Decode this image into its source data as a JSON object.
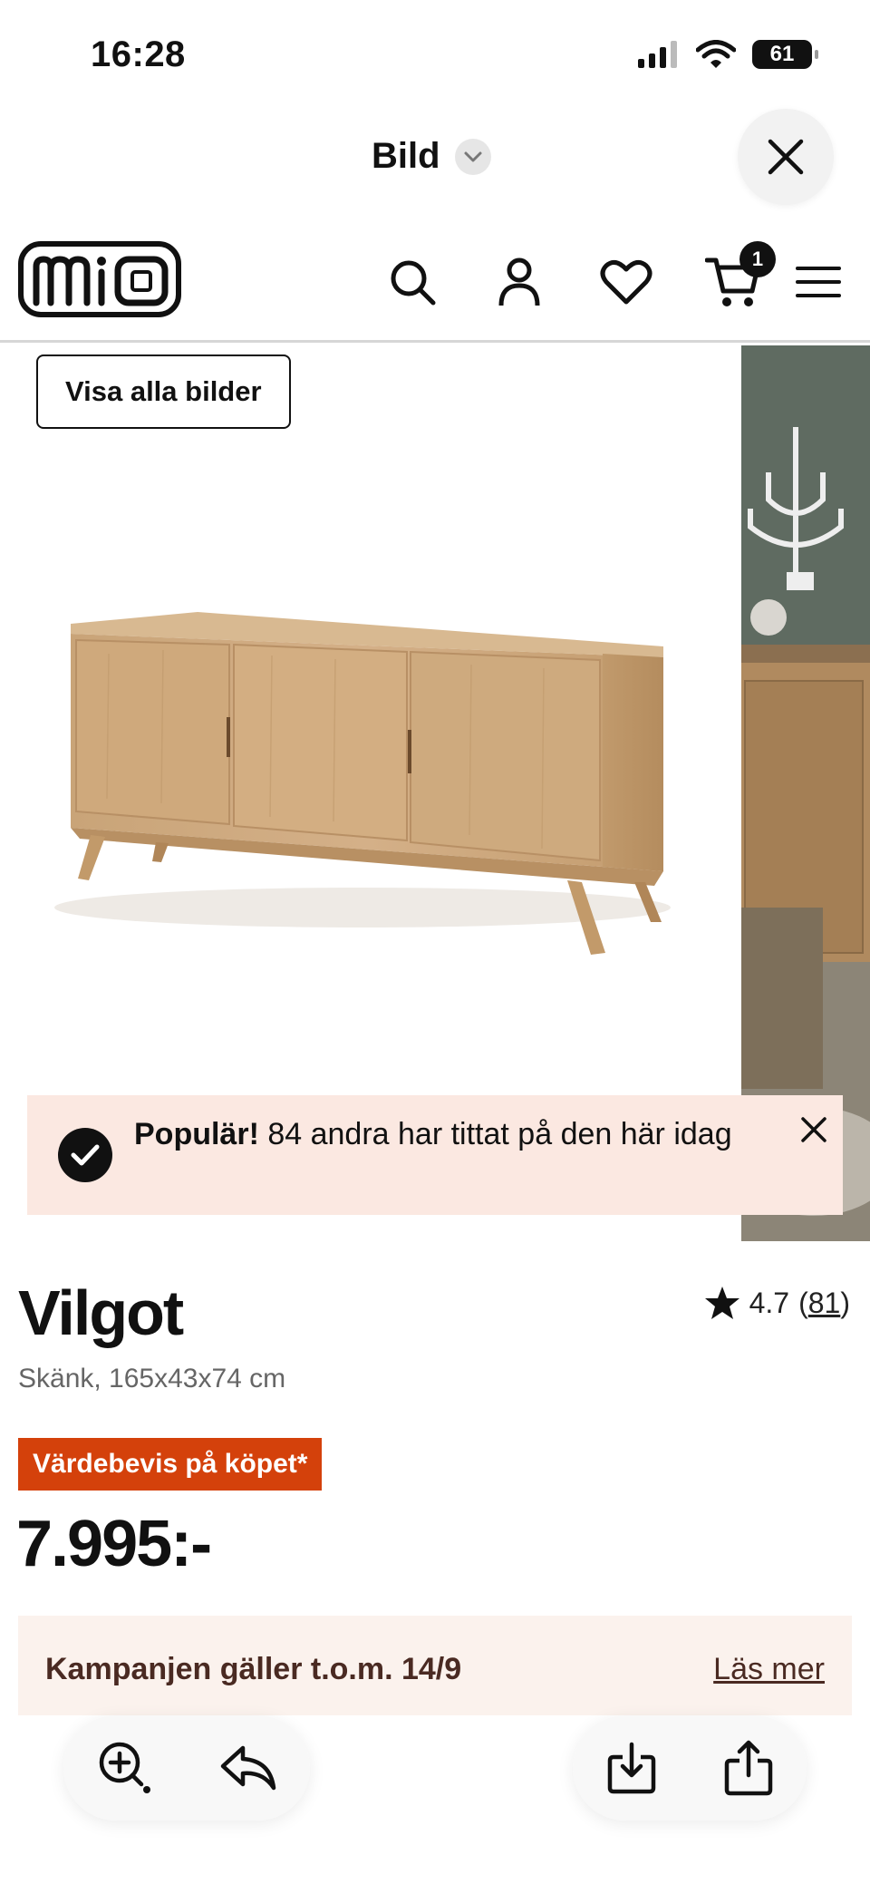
{
  "status_bar": {
    "time": "16:28",
    "battery": "61"
  },
  "viewer": {
    "title": "Bild"
  },
  "site": {
    "logo": "mio",
    "cart_count": "1"
  },
  "gallery": {
    "show_all_label": "Visa alla bilder"
  },
  "popular": {
    "bold": "Populär!",
    "text": " 84 andra har tittat på den här idag"
  },
  "product": {
    "name": "Vilgot",
    "subtitle": "Skänk, 165x43x74 cm",
    "rating": "4.7",
    "review_count": "81",
    "badge": "Värdebevis på köpet*",
    "price": "7.995:-"
  },
  "campaign": {
    "text": "Kampanjen gäller t.o.m. 14/9",
    "link": "Läs mer"
  },
  "colors": {
    "badge": "#d4410b",
    "popular_bg": "#fbe8e1",
    "campaign_bg": "#fbf2ed"
  },
  "icons": [
    "chevron-down-icon",
    "close-icon",
    "search-icon",
    "user-icon",
    "heart-icon",
    "cart-icon",
    "menu-icon",
    "check-icon",
    "star-icon",
    "zoom-icon",
    "reply-icon",
    "download-icon",
    "share-icon"
  ]
}
